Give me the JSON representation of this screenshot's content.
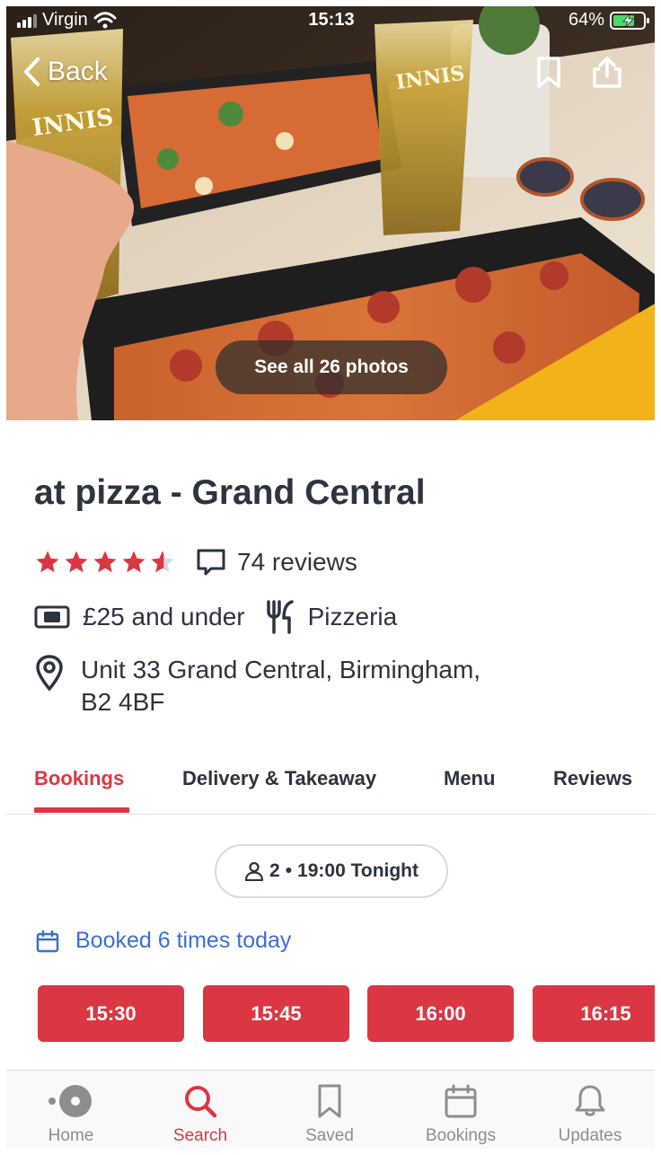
{
  "status_bar": {
    "carrier": "Virgin",
    "time": "15:13",
    "battery": "64%"
  },
  "hero": {
    "back_label": "Back",
    "photos_label": "See all 26 photos"
  },
  "restaurant": {
    "name": "at pizza - Grand Central",
    "rating_stars": 4.5,
    "reviews": "74 reviews",
    "price": "£25 and under",
    "cuisine": "Pizzeria",
    "address_line1": "Unit 33 Grand Central, Birmingham,",
    "address_line2": "B2 4BF"
  },
  "tabs": [
    {
      "label": "Bookings",
      "active": true
    },
    {
      "label": "Delivery & Takeaway",
      "active": false
    },
    {
      "label": "Menu",
      "active": false
    },
    {
      "label": "Reviews",
      "active": false
    }
  ],
  "booking": {
    "party_size": "2",
    "separator": "•",
    "time_label": "19:00 Tonight",
    "booked_today": "Booked 6 times today",
    "slots": [
      "15:30",
      "15:45",
      "16:00",
      "16:15"
    ]
  },
  "bottom_nav": [
    {
      "label": "Home",
      "icon": "home-icon",
      "active": false
    },
    {
      "label": "Search",
      "icon": "search-icon",
      "active": true
    },
    {
      "label": "Saved",
      "icon": "bookmark-icon",
      "active": false
    },
    {
      "label": "Bookings",
      "icon": "calendar-icon",
      "active": false
    },
    {
      "label": "Updates",
      "icon": "bell-icon",
      "active": false
    }
  ],
  "colors": {
    "brand_red": "#da3743",
    "link_blue": "#3e6ed1",
    "text_dark": "#2d333f",
    "nav_gray": "#8d8d8d",
    "battery_green": "#4cd964"
  }
}
